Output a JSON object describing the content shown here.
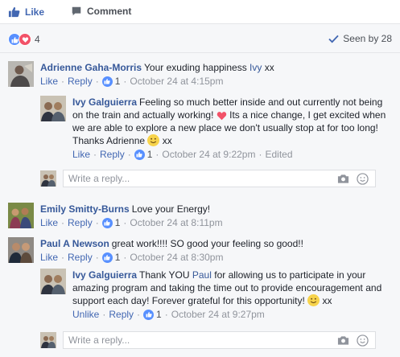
{
  "actions": {
    "like_label": "Like",
    "comment_label": "Comment"
  },
  "summary": {
    "reaction_count": "4",
    "seen_label": "Seen by 28"
  },
  "labels": {
    "like": "Like",
    "reply": "Reply",
    "unlike": "Unlike",
    "edited": "Edited"
  },
  "comments": [
    {
      "author": "Adrienne Gaha-Morris",
      "text": "Your exuding happiness",
      "mention": "Ivy",
      "text_after": " xx",
      "likes": "1",
      "time": "October 24 at 4:15pm"
    },
    {
      "author": "Ivy Galguierra",
      "text_lines": [
        "Feeling so much better inside and out currently not",
        "being on the train and actually working!",
        " Its a nice change, I get",
        "excited when we are able to explore a new place we don't usually stop",
        "at for too long! Thanks Adrienne",
        " xx"
      ],
      "likes": "1",
      "time": "October 24 at 9:22pm"
    },
    {
      "author": "Emily Smitty-Burns",
      "text": "Love your Energy!",
      "likes": "1",
      "time": "October 24 at 8:11pm"
    },
    {
      "author": "Paul A Newson",
      "text": "great work!!!! SO good your feeling so good!!",
      "likes": "1",
      "time": "October 24 at 8:30pm"
    },
    {
      "author": "Ivy Galguierra",
      "text_lines": [
        "Thank YOU",
        "Paul",
        " for allowing us to participate in your",
        "amazing program and taking the time out to provide encouragement",
        "and support each day! Forever grateful for this opportunity!",
        " xx"
      ],
      "likes": "1",
      "time": "October 24 at 9:27pm"
    }
  ],
  "reply_placeholder": "Write a reply...",
  "colors": {
    "accent": "#4267b2",
    "link": "#365899",
    "love": "#f25268",
    "like_badge": "#5890ff"
  }
}
